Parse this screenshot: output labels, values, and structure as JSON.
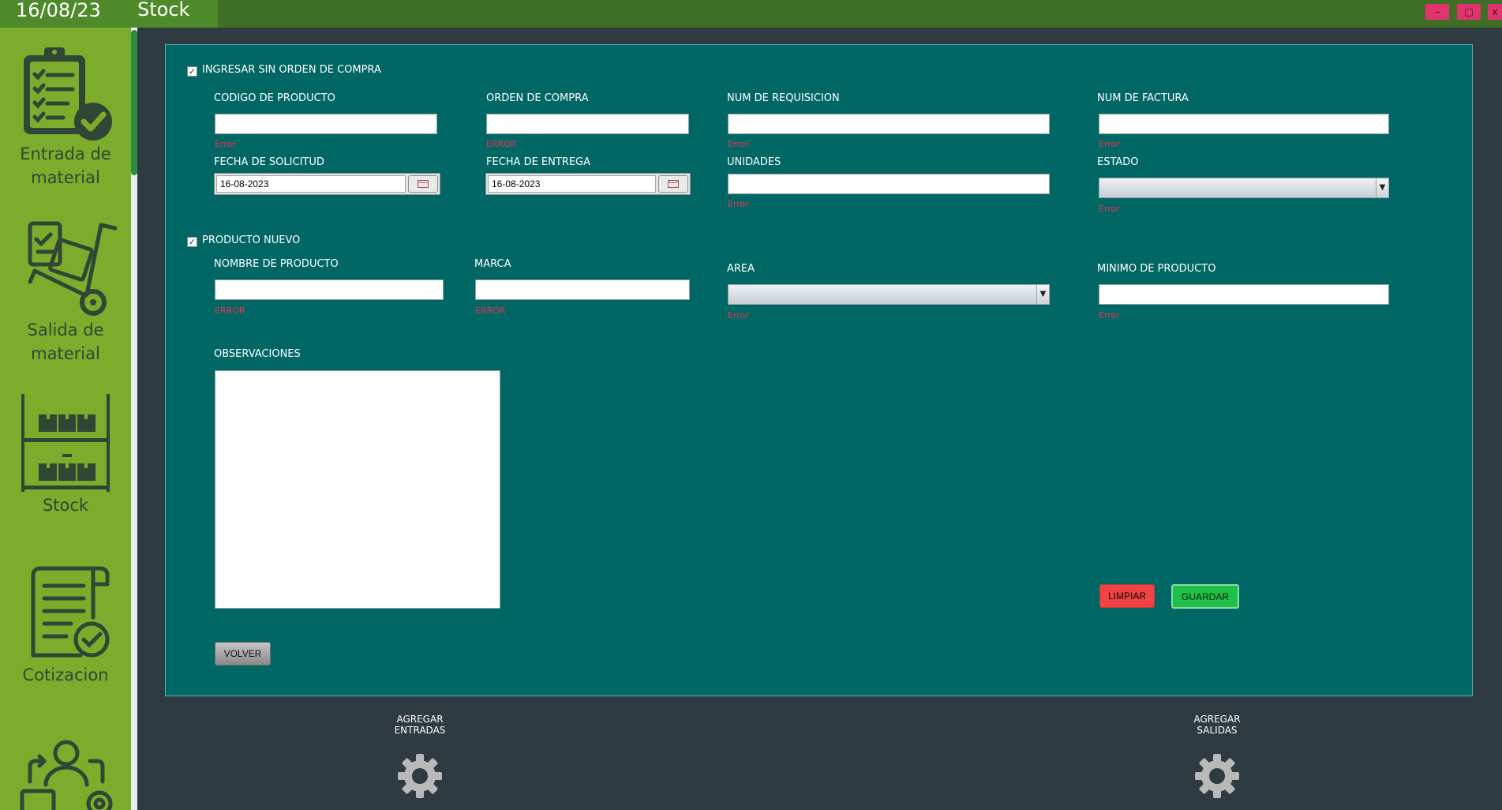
{
  "titlebar": {
    "date": "16/08/23",
    "title": "Stock",
    "minimize": "–",
    "maximize": "□",
    "close": "x"
  },
  "sidebar": {
    "items": [
      {
        "label_line1": "Entrada de",
        "label_line2": "material",
        "icon": "clipboard-check-icon"
      },
      {
        "label_line1": "Salida de",
        "label_line2": "material",
        "icon": "hand-truck-icon"
      },
      {
        "label": "Stock",
        "icon": "shelves-icon"
      },
      {
        "label": "Cotizacion",
        "icon": "document-check-icon"
      },
      {
        "icon": "worker-process-icon"
      }
    ]
  },
  "form": {
    "checkbox_no_po": {
      "label": "INGRESAR SIN ORDEN DE COMPRA",
      "checked": true
    },
    "codigo_producto": {
      "label": "CODIGO DE PRODUCTO",
      "value": "",
      "error": "Error"
    },
    "orden_compra": {
      "label": "ORDEN DE COMPRA",
      "value": "",
      "error": "ERROR"
    },
    "num_requisicion": {
      "label": "NUM DE REQUISICION",
      "value": "",
      "error": "Error"
    },
    "num_factura": {
      "label": "NUM DE FACTURA",
      "value": "",
      "error": "Error"
    },
    "fecha_solicitud": {
      "label": "FECHA DE SOLICITUD",
      "value": "16-08-2023"
    },
    "fecha_entrega": {
      "label": "FECHA DE ENTREGA",
      "value": "16-08-2023"
    },
    "unidades": {
      "label": "UNIDADES",
      "value": "",
      "error": "Error"
    },
    "estado": {
      "label": "ESTADO",
      "value": "",
      "error": "Error"
    },
    "checkbox_nuevo": {
      "label": "PRODUCTO NUEVO",
      "checked": true
    },
    "nombre_producto": {
      "label": "NOMBRE DE PRODUCTO",
      "value": "",
      "error": "ERROR"
    },
    "marca": {
      "label": "MARCA",
      "value": "",
      "error": "ERROR"
    },
    "area": {
      "label": "AREA",
      "value": "",
      "error": "Error"
    },
    "minimo_producto": {
      "label": "MINIMO DE PRODUCTO",
      "value": "",
      "error": "Error"
    },
    "observaciones": {
      "label": "OBSERVACIONES",
      "value": ""
    },
    "buttons": {
      "limpiar": "LIMPIAR",
      "guardar": "GUARDAR",
      "volver": "VOLVER"
    }
  },
  "bottom": {
    "agregar_entradas_l1": "AGREGAR",
    "agregar_entradas_l2": "ENTRADAS",
    "agregar_salidas_l1": "AGREGAR",
    "agregar_salidas_l2": "SALIDAS"
  },
  "colors": {
    "titlebar": "#3f6e27",
    "sidebar": "#7cac2c",
    "panel": "#006765",
    "background": "#2e3b41",
    "error": "#ee2f4c",
    "limpiar": "#f04343",
    "guardar": "#1fc04a",
    "window_buttons": "#e1336e"
  }
}
